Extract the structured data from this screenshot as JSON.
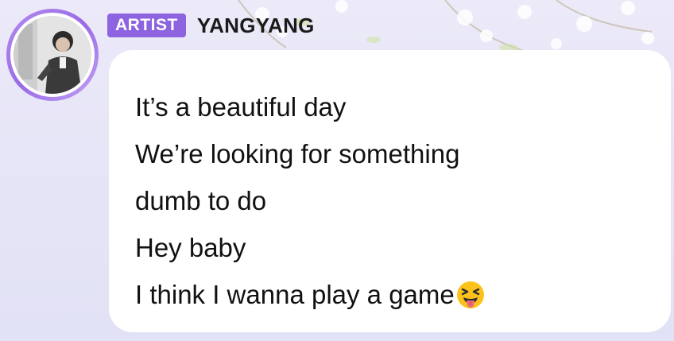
{
  "author": {
    "role_badge": "ARTIST",
    "name": "YANGYANG",
    "avatar_ring_color": "#9a6ae6"
  },
  "message": {
    "lines": [
      "It’s a beautiful day",
      "We’re looking for something",
      "dumb to do",
      "Hey baby",
      "I think I wanna play a game"
    ],
    "trailing_emoji": "squinting-face-with-tongue-icon"
  },
  "colors": {
    "badge_bg": "#8d63e0",
    "background": "#e6e5f7",
    "bubble_bg": "#ffffff"
  }
}
